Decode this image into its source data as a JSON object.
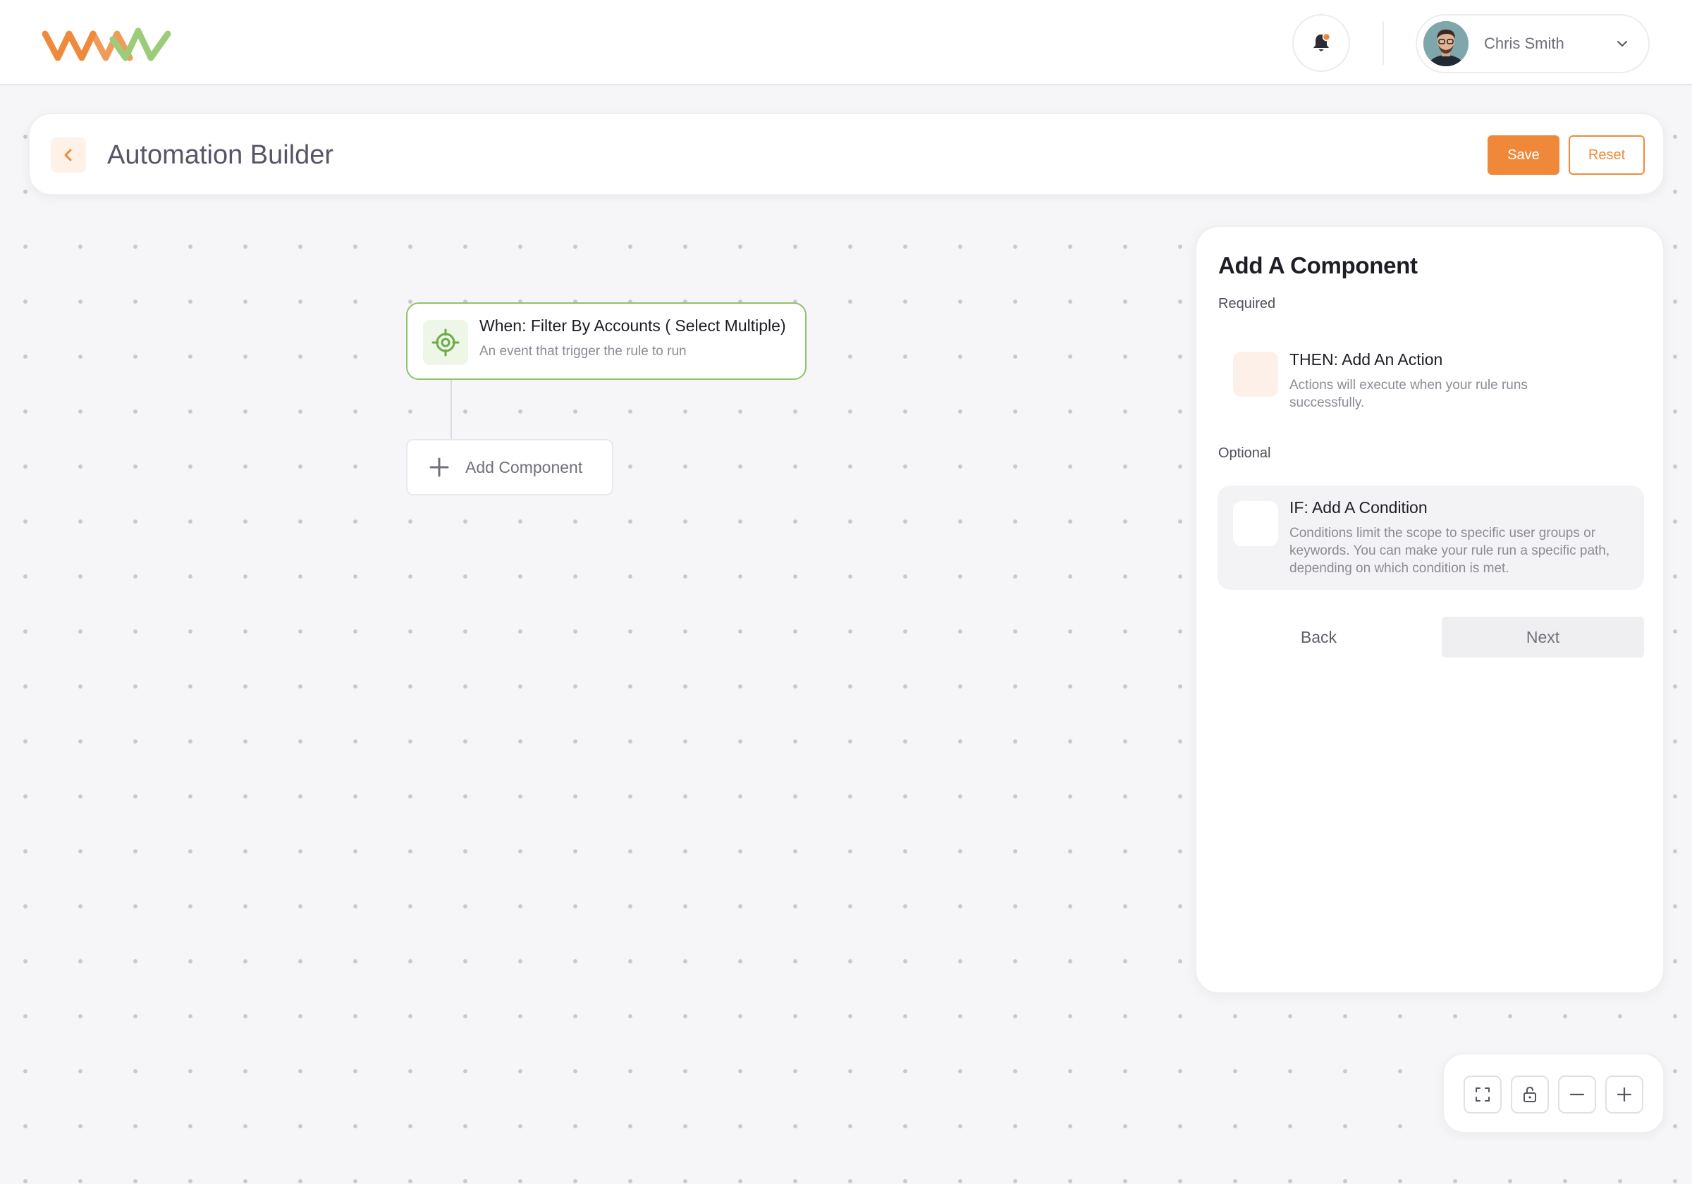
{
  "user": {
    "name": "Chris Smith"
  },
  "icons": {
    "logo": "wave-logo",
    "bell": "bell-icon",
    "chevron": "chevron-down-icon",
    "back": "chevron-left-icon",
    "trigger": "target-icon",
    "add": "plus-icon",
    "fit": "fit-view-icon",
    "lock": "unlock-icon",
    "zoom_out": "minus-icon",
    "zoom_in": "plus-icon"
  },
  "colors": {
    "accent": "#f0883a",
    "logo_orange": "#ef8a3d",
    "logo_green": "#9ccb7a",
    "trigger_border": "#8ec36b",
    "trigger_icon": "#6cab45"
  },
  "header": {
    "title": "Automation Builder",
    "save_label": "Save",
    "reset_label": "Reset"
  },
  "canvas": {
    "trigger": {
      "title": "When: Filter By Accounts ( Select Multiple)",
      "subtitle": "An event that trigger the rule to run"
    },
    "add_component_label": "Add Component"
  },
  "panel": {
    "title": "Add A Component",
    "required_label": "Required",
    "optional_label": "Optional",
    "action": {
      "title": "THEN: Add An Action",
      "description": "Actions will execute when your rule runs successfully."
    },
    "condition": {
      "title": "IF: Add A Condition",
      "description": "Conditions limit the scope to specific user groups or keywords. You can make your rule run a specific path, depending on which condition is met."
    },
    "back_label": "Back",
    "next_label": "Next"
  }
}
